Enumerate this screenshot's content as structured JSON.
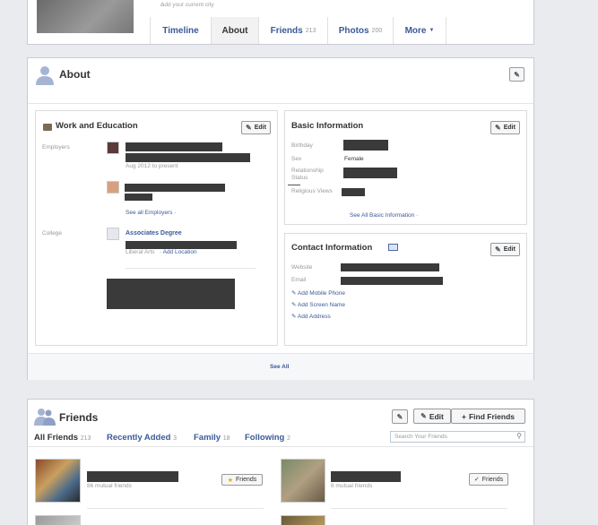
{
  "profile": {
    "add_city": "Add your current city",
    "tabs": [
      {
        "label": "Timeline",
        "count": ""
      },
      {
        "label": "About",
        "count": ""
      },
      {
        "label": "Friends",
        "count": "213"
      },
      {
        "label": "Photos",
        "count": "200"
      },
      {
        "label": "More",
        "count": ""
      }
    ]
  },
  "about": {
    "title": "About",
    "see_all": "See All",
    "work": {
      "title": "Work and Education",
      "edit": "Edit",
      "employers_label": "Employers",
      "employer_dates": "Aug 2012 to present",
      "see_all_employers": "See all Employers ·",
      "college_label": "College",
      "college_degree": "Associates Degree",
      "college_major": "Liberal Arts",
      "add_location": "· Add Location"
    },
    "basic": {
      "title": "Basic Information",
      "edit": "Edit",
      "birthday_label": "Birthday",
      "sex_label": "Sex",
      "sex_value": "Female",
      "relationship_label_1": "Relationship",
      "relationship_label_2": "Status",
      "religious_label": "Religious Views",
      "see_all": "See All Basic Information ·"
    },
    "contact": {
      "title": "Contact Information",
      "edit": "Edit",
      "website_label": "Website",
      "email_label": "Email",
      "add_mobile": "Add Mobile Phone",
      "add_screen": "Add Screen Name",
      "add_address": "Add Address"
    }
  },
  "friends": {
    "title": "Friends",
    "edit": "Edit",
    "find": "Find Friends",
    "search_placeholder": "Search Your Friends",
    "tabs": [
      {
        "label": "All Friends",
        "count": "213"
      },
      {
        "label": "Recently Added",
        "count": "3"
      },
      {
        "label": "Family",
        "count": "18"
      },
      {
        "label": "Following",
        "count": "2"
      }
    ],
    "items": [
      {
        "mutual": "86 mutual friends",
        "button": "Friends"
      },
      {
        "mutual": "6 mutual friends",
        "button": "Friends"
      }
    ]
  }
}
